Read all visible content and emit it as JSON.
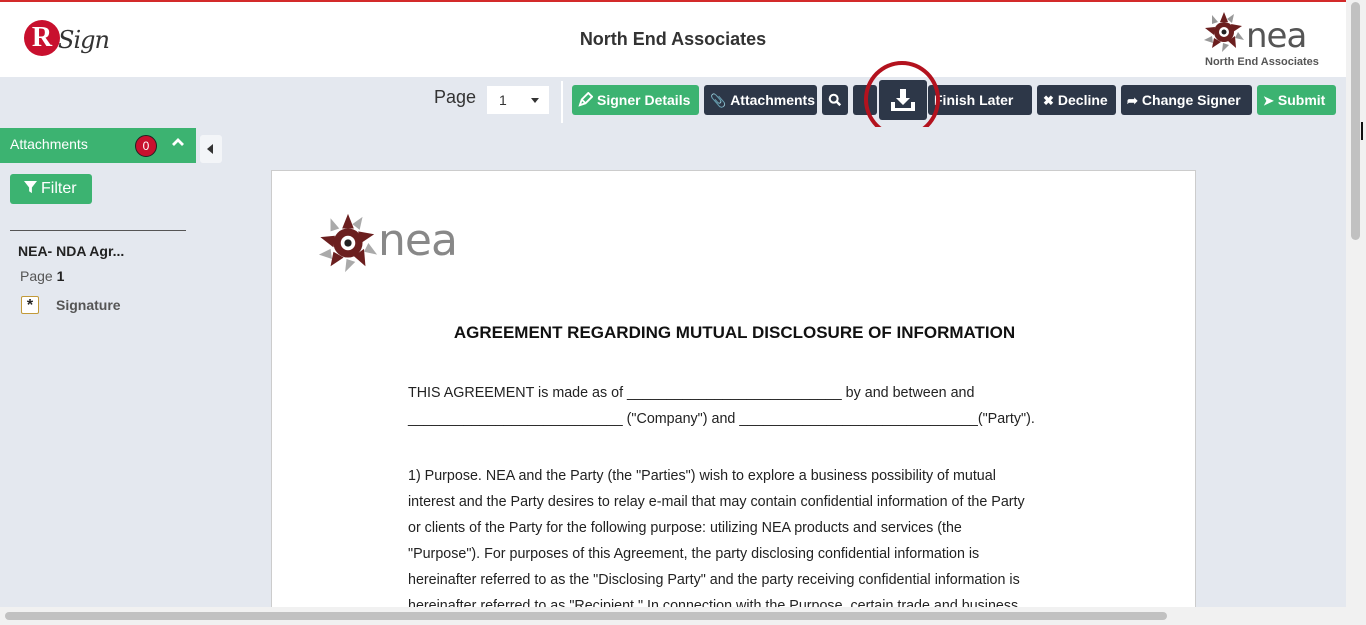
{
  "header": {
    "logo_letter": "R",
    "logo_text": "Sign",
    "company_title": "North End Associates",
    "brand_logo_text": "nea",
    "brand_logo_subtitle": "North End Associates"
  },
  "toolbar": {
    "page_label": "Page",
    "page_value": "1",
    "buttons": {
      "signer_details": "Signer Details",
      "attachments": "Attachments",
      "finish_later": "Finish Later",
      "decline": "Decline",
      "change_signer": "Change Signer",
      "submit": "Submit"
    }
  },
  "sidebar": {
    "header_label": "Attachments",
    "badge_count": "0",
    "filter_label": "Filter",
    "document_name": "NEA- NDA Agr...",
    "page_prefix": "Page",
    "page_number": "1",
    "field_label": "Signature"
  },
  "document": {
    "logo_text": "nea",
    "title": "AGREEMENT REGARDING MUTUAL DISCLOSURE OF INFORMATION",
    "para1_line1": "THIS AGREEMENT is made as of ___________________________ by and between and",
    "para1_line2": "___________________________ (\"Company\") and ______________________________(\"Party\").",
    "para2_line1": "1) Purpose.  NEA and the Party (the \"Parties\") wish to explore a business possibility of mutual",
    "para2_line2": "interest and the Party desires to relay e-mail that may contain confidential information of the Party",
    "para2_line3": "or clients of the Party for the following purpose: utilizing NEA products and services (the",
    "para2_line4": "\"Purpose\").  For purposes of this Agreement, the party disclosing confidential information is",
    "para2_line5": "hereinafter referred to as the \"Disclosing Party\" and the party receiving confidential information is",
    "para2_line6": "hereinafter referred to as \"Recipient.\"  In connection with the Purpose, certain trade and business"
  },
  "colors": {
    "green": "#3cb371",
    "dark": "#2d3748",
    "red": "#b3121e",
    "toolbar_bg": "#e4e8ef"
  }
}
